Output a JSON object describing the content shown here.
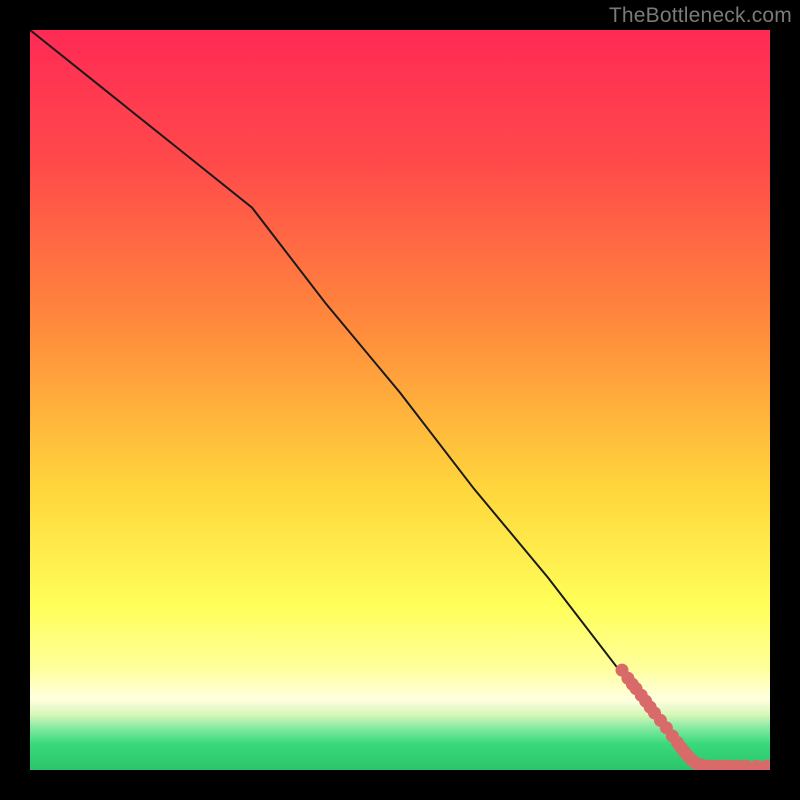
{
  "watermark": "TheBottleneck.com",
  "colors": {
    "frame": "#000000",
    "line": "#1a1a1a",
    "marker": "#d96a6a",
    "gradient_top": "#ff2a55",
    "gradient_mid_upper": "#ff8a3c",
    "gradient_mid": "#ffd63c",
    "gradient_mid_lower": "#ffff8a",
    "gradient_low_band": "#ffffe0",
    "gradient_green_band": "#39d97a",
    "gradient_bottom": "#2cc46a"
  },
  "chart_data": {
    "type": "line",
    "title": "",
    "xlabel": "",
    "ylabel": "",
    "xlim": [
      0,
      100
    ],
    "ylim": [
      0,
      100
    ],
    "series": [
      {
        "name": "curve",
        "x": [
          0,
          10,
          20,
          30,
          40,
          50,
          60,
          70,
          80,
          85,
          87,
          90,
          95,
          100
        ],
        "y": [
          100,
          92,
          84,
          76,
          63,
          51,
          38,
          26,
          13,
          7,
          4.5,
          1.2,
          0.5,
          0.5
        ]
      }
    ],
    "markers": {
      "name": "bottleneck-points",
      "points": [
        {
          "x": 80.0,
          "y": 13.5
        },
        {
          "x": 80.8,
          "y": 12.4
        },
        {
          "x": 81.4,
          "y": 11.6
        },
        {
          "x": 81.9,
          "y": 11.0
        },
        {
          "x": 82.6,
          "y": 10.1
        },
        {
          "x": 83.2,
          "y": 9.3
        },
        {
          "x": 83.8,
          "y": 8.5
        },
        {
          "x": 84.4,
          "y": 7.7
        },
        {
          "x": 85.2,
          "y": 6.7
        },
        {
          "x": 86.0,
          "y": 5.7
        },
        {
          "x": 86.8,
          "y": 4.6
        },
        {
          "x": 87.5,
          "y": 3.7
        },
        {
          "x": 88.0,
          "y": 3.0
        },
        {
          "x": 88.5,
          "y": 2.4
        },
        {
          "x": 89.0,
          "y": 1.8
        },
        {
          "x": 89.5,
          "y": 1.3
        },
        {
          "x": 90.0,
          "y": 0.9
        },
        {
          "x": 90.5,
          "y": 0.7
        },
        {
          "x": 91.0,
          "y": 0.6
        },
        {
          "x": 91.8,
          "y": 0.5
        },
        {
          "x": 92.5,
          "y": 0.5
        },
        {
          "x": 93.2,
          "y": 0.5
        },
        {
          "x": 94.0,
          "y": 0.5
        },
        {
          "x": 94.8,
          "y": 0.5
        },
        {
          "x": 95.8,
          "y": 0.5
        },
        {
          "x": 96.8,
          "y": 0.5
        },
        {
          "x": 98.2,
          "y": 0.5
        },
        {
          "x": 99.5,
          "y": 0.5
        }
      ]
    },
    "gradient_stops": [
      {
        "offset": 0.0,
        "color": "#ff2a55"
      },
      {
        "offset": 0.18,
        "color": "#ff4a4a"
      },
      {
        "offset": 0.4,
        "color": "#ff8a3c"
      },
      {
        "offset": 0.62,
        "color": "#ffd63c"
      },
      {
        "offset": 0.78,
        "color": "#ffff5a"
      },
      {
        "offset": 0.86,
        "color": "#ffff9a"
      },
      {
        "offset": 0.905,
        "color": "#ffffe0"
      },
      {
        "offset": 0.925,
        "color": "#d8f7b8"
      },
      {
        "offset": 0.945,
        "color": "#7de89e"
      },
      {
        "offset": 0.965,
        "color": "#39d97a"
      },
      {
        "offset": 1.0,
        "color": "#2cc46a"
      }
    ]
  }
}
